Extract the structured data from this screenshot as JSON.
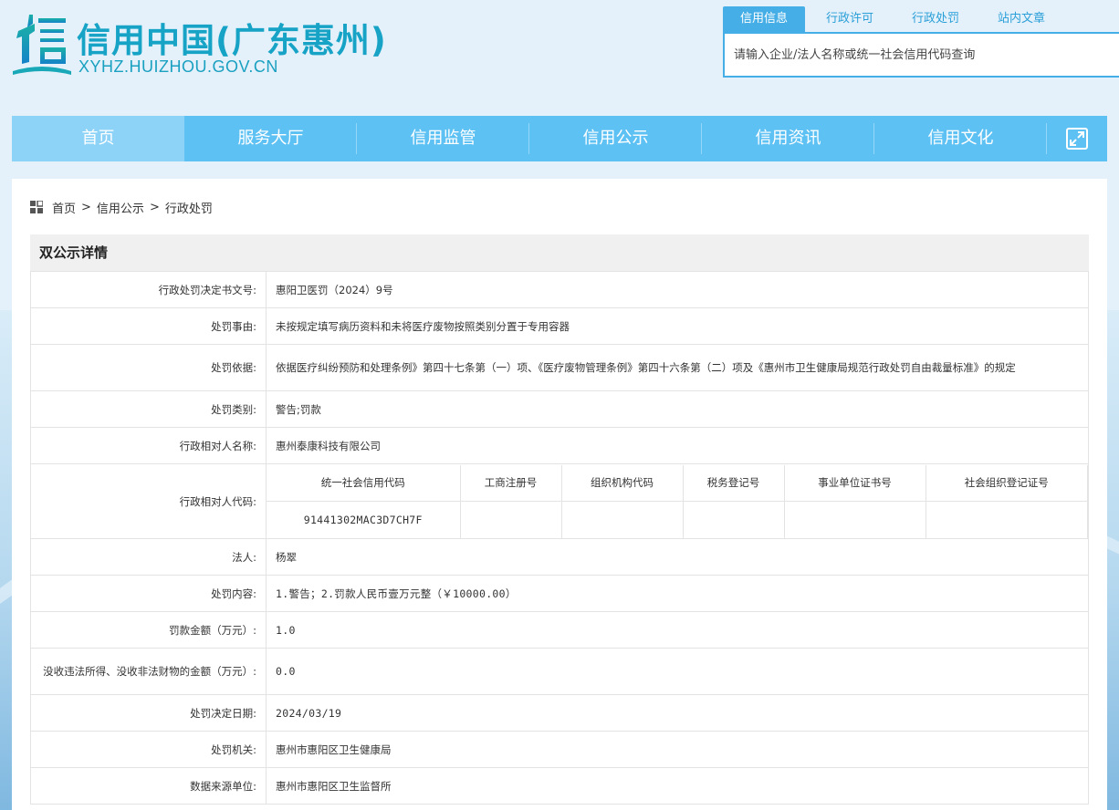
{
  "site": {
    "title": "信用中国(广东惠州)",
    "domain": "XYHZ.HUIZHOU.GOV.CN",
    "logo_icon": "xin-logo-icon",
    "brand_color": "#16a3c6"
  },
  "search": {
    "tabs": [
      "信用信息",
      "行政许可",
      "行政处罚",
      "站内文章"
    ],
    "active_tab": 0,
    "placeholder": "请输入企业/法人名称或统一社会信用代码查询"
  },
  "nav": {
    "items": [
      "首页",
      "服务大厅",
      "信用监管",
      "信用公示",
      "信用资讯",
      "信用文化"
    ],
    "active": 0,
    "expand_icon": "fullscreen-icon",
    "color": "#5ec1f4"
  },
  "breadcrumb": {
    "icon": "grid-icon",
    "items": [
      "首页",
      "信用公示",
      "行政处罚"
    ],
    "separator": ">"
  },
  "detail": {
    "title": "双公示详情",
    "decision_no": {
      "label": "行政处罚决定书文号:",
      "value": "惠阳卫医罚（2024）9号"
    },
    "reason": {
      "label": "处罚事由:",
      "value": "未按规定填写病历资料和未将医疗废物按照类别分置于专用容器"
    },
    "basis": {
      "label": "处罚依据:",
      "value": "依据医疗纠纷预防和处理条例》第四十七条第（一）项、《医疗废物管理条例》第四十六条第（二）项及《惠州市卫生健康局规范行政处罚自由裁量标准》的规定"
    },
    "category": {
      "label": "处罚类别:",
      "value": "警告;罚款"
    },
    "party_name": {
      "label": "行政相对人名称:",
      "value": "惠州泰康科技有限公司"
    },
    "party_code": {
      "label": "行政相对人代码:",
      "headers": [
        "统一社会信用代码",
        "工商注册号",
        "组织机构代码",
        "税务登记号",
        "事业单位证书号",
        "社会组织登记证号"
      ],
      "values": [
        "91441302MAC3D7CH7F",
        "",
        "",
        "",
        "",
        ""
      ]
    },
    "legal_person": {
      "label": "法人:",
      "value": "杨翠"
    },
    "content": {
      "label": "处罚内容:",
      "value": "1.警告；2.罚款人民币壹万元整（￥10000.00）"
    },
    "fine": {
      "label": "罚款金额（万元）:",
      "value": "1.0"
    },
    "confiscation": {
      "label": "没收违法所得、没收非法财物的金额（万元）:",
      "value": "0.0"
    },
    "date": {
      "label": "处罚决定日期:",
      "value": "2024/03/19"
    },
    "authority": {
      "label": "处罚机关:",
      "value": "惠州市惠阳区卫生健康局"
    },
    "source": {
      "label": "数据来源单位:",
      "value": "惠州市惠阳区卫生监督所"
    }
  }
}
